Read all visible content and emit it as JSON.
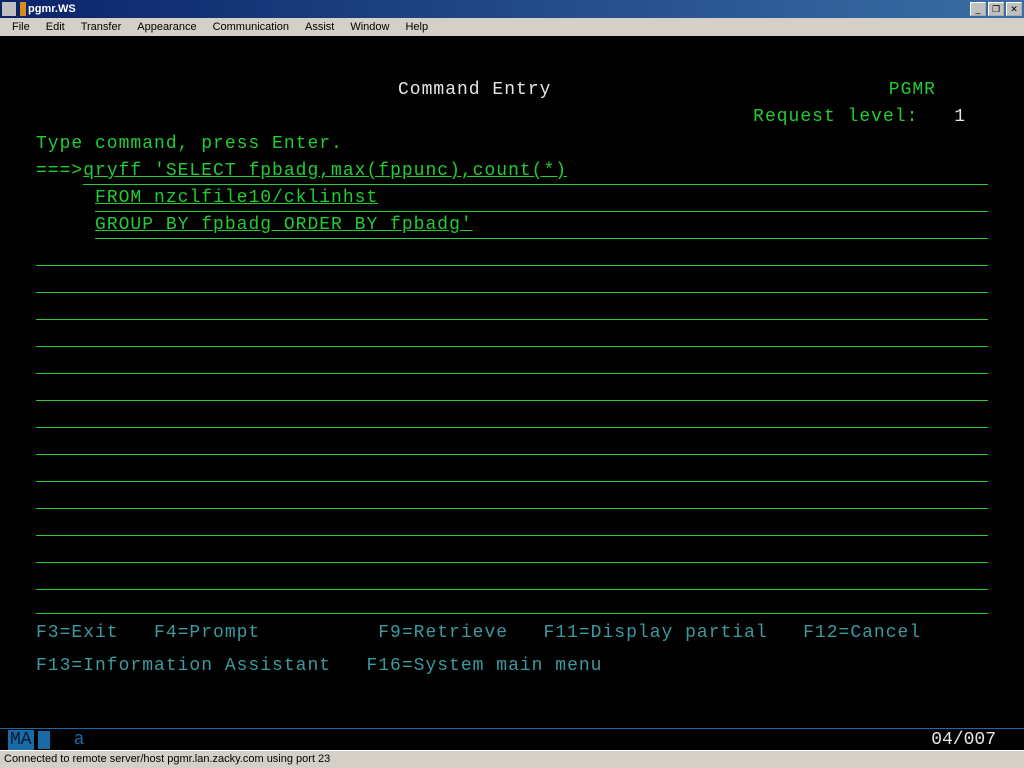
{
  "window": {
    "title": "pgmr.WS"
  },
  "menu": {
    "file": "File",
    "edit": "Edit",
    "transfer": "Transfer",
    "appearance": "Appearance",
    "communication": "Communication",
    "assist": "Assist",
    "window": "Window",
    "help": "Help"
  },
  "screen": {
    "title": "Command Entry",
    "user": "PGMR",
    "request_label": "Request level:",
    "request_value": "1",
    "instruction": "Type command, press Enter.",
    "prompt": "===>",
    "command_lines": [
      "qryff 'SELECT fpbadg,max(fppunc),count(*)",
      "FROM nzclfile10/cklinhst",
      "GROUP BY fpbadg ORDER BY fpbadg'"
    ]
  },
  "fkeys": {
    "row1": "F3=Exit   F4=Prompt          F9=Retrieve   F11=Display partial   F12=Cancel",
    "row2": "F13=Information Assistant   F16=System main menu"
  },
  "term_status": {
    "mode": "MA",
    "indicator": "a",
    "position": "04/007"
  },
  "statusbar": {
    "text": "Connected to remote server/host pgmr.lan.zacky.com using port 23"
  },
  "win_controls": {
    "min": "_",
    "max": "❐",
    "close": "✕"
  }
}
